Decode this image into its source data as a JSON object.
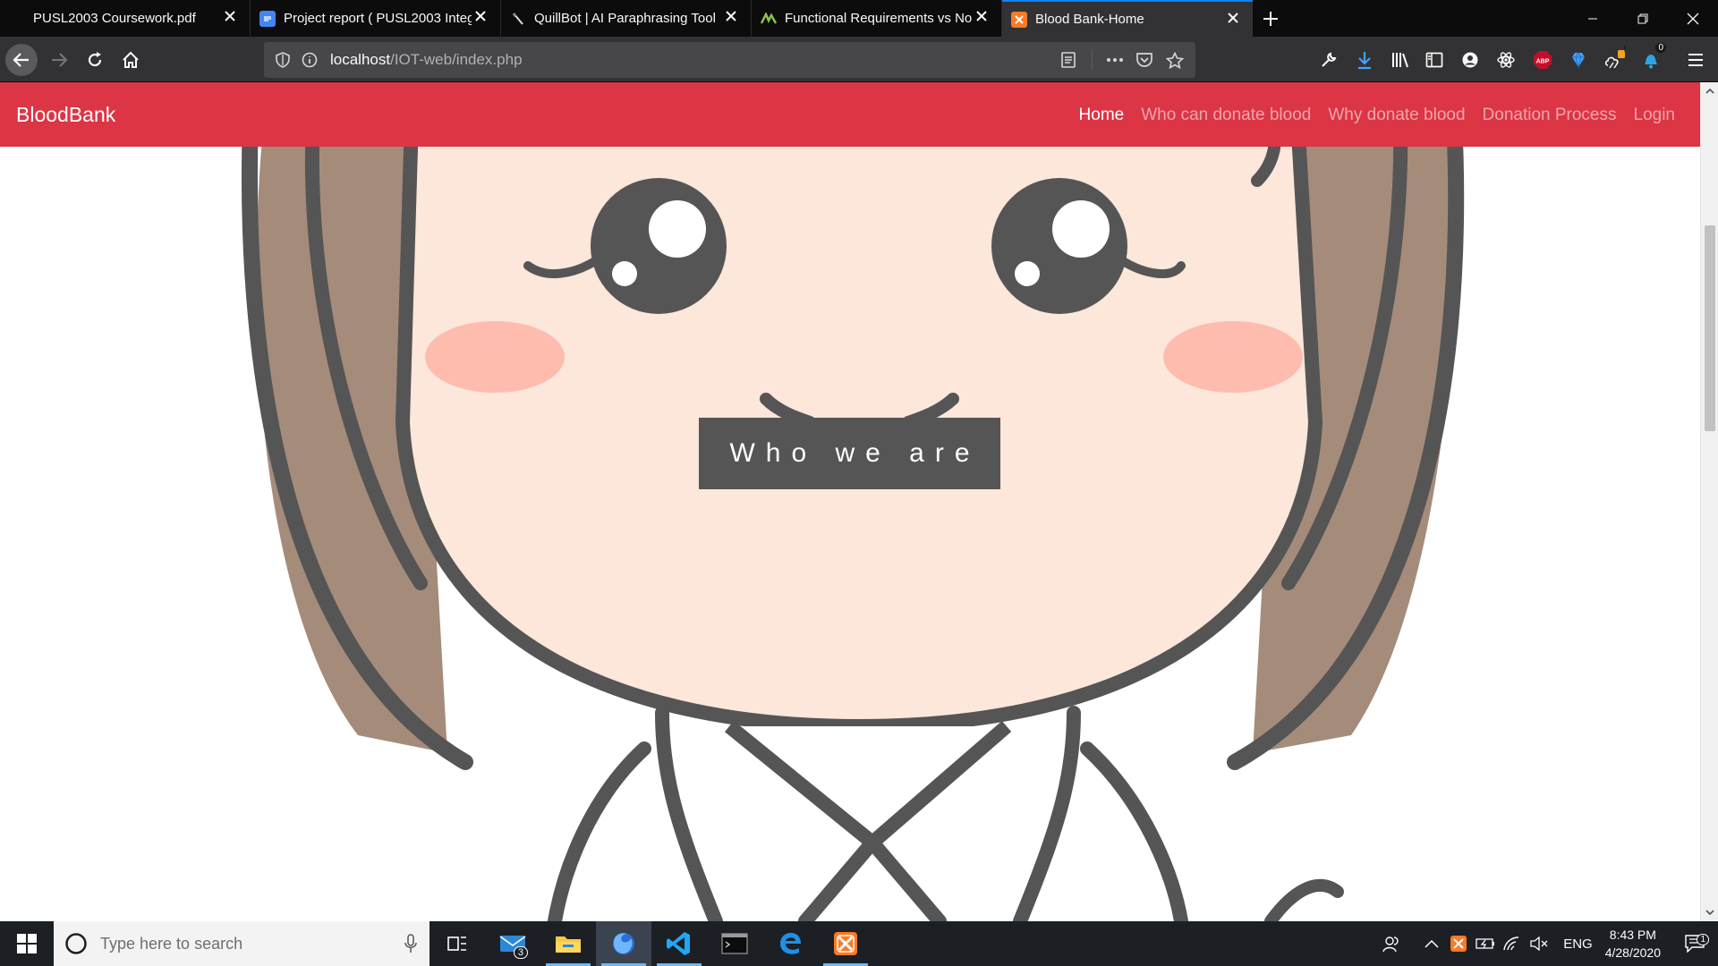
{
  "tabs": [
    {
      "title": "PUSL2003 Coursework.pdf",
      "icon": "pdf-icon",
      "active": false
    },
    {
      "title": "Project report ( PUSL2003 Integ",
      "icon": "google-docs-icon",
      "active": false
    },
    {
      "title": "QuillBot | AI Paraphrasing Tool",
      "icon": "quillbot-icon",
      "active": false
    },
    {
      "title": "Functional Requirements vs No",
      "icon": "green-site-icon",
      "active": false
    },
    {
      "title": "Blood Bank-Home",
      "icon": "xampp-icon",
      "active": true
    }
  ],
  "address": {
    "host": "localhost",
    "path": "/IOT-web/index.php"
  },
  "toolbar": {
    "download_badge": "",
    "notifications_badge": "0",
    "weather_badge": "!"
  },
  "site": {
    "brand": "BloodBank",
    "nav": [
      {
        "label": "Home",
        "active": true
      },
      {
        "label": "Who can donate blood",
        "active": false
      },
      {
        "label": "Why donate blood",
        "active": false
      },
      {
        "label": "Donation Process",
        "active": false
      },
      {
        "label": "Login",
        "active": false
      }
    ],
    "hero_caption": "Who we are"
  },
  "taskbar": {
    "search_placeholder": "Type here to search",
    "mail_badge": "3",
    "language": "ENG",
    "time": "8:43 PM",
    "date": "4/28/2020",
    "notification_count": "1"
  },
  "colors": {
    "brand_red": "#dc3545",
    "accent_blue": "#0a84ff",
    "caption_bg": "#555555"
  }
}
